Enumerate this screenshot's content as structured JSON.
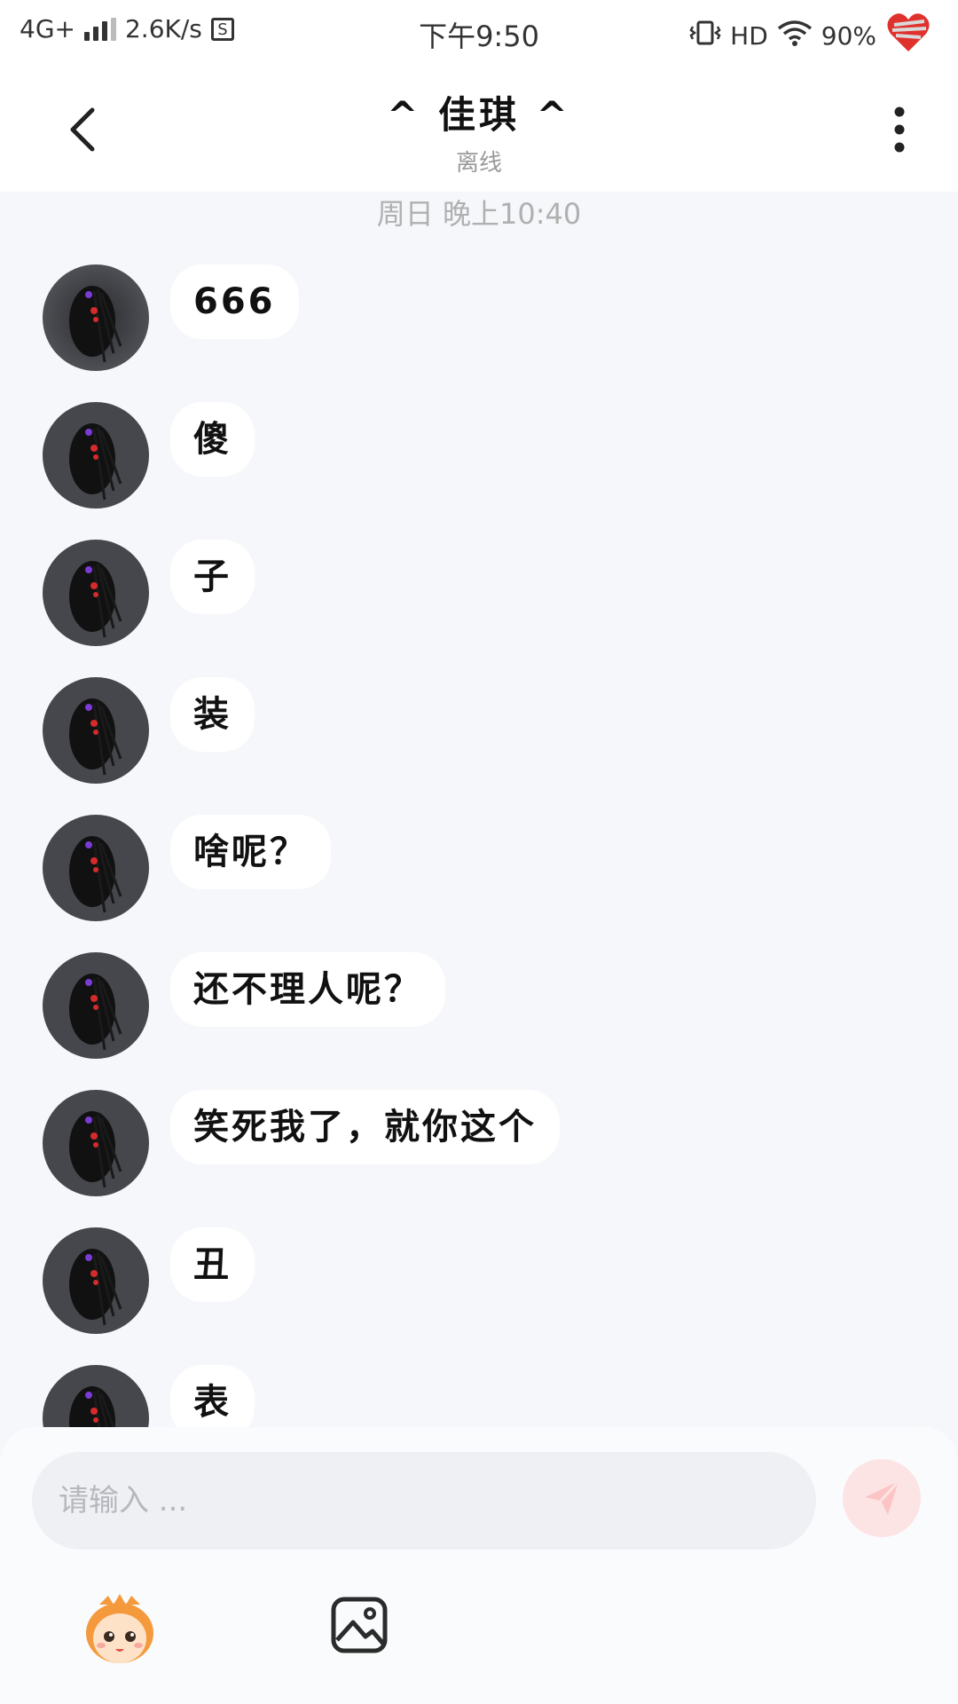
{
  "status_bar": {
    "network": "4G+",
    "speed": "2.6K/s",
    "sim_badge": "S",
    "time": "下午9:50",
    "hd": "HD",
    "battery": "90%"
  },
  "header": {
    "back_icon": "chevron-left-icon",
    "title": "^ 佳琪 ^",
    "status": "离线",
    "more_icon": "vertical-dots-icon"
  },
  "chat": {
    "timestamp": "周日 晚上10:40",
    "messages": [
      {
        "text": "666"
      },
      {
        "text": "傻"
      },
      {
        "text": "子"
      },
      {
        "text": "装"
      },
      {
        "text": "啥呢？"
      },
      {
        "text": "还不理人呢？"
      },
      {
        "text": "笑死我了，就你这个"
      },
      {
        "text": "丑"
      },
      {
        "text": "表"
      }
    ]
  },
  "composer": {
    "placeholder": "请输入 ...",
    "send_icon": "paper-plane-icon",
    "emoji_icon": "cartoon-face-icon",
    "image_icon": "image-icon"
  },
  "colors": {
    "background": "#f6f7fa",
    "bubble": "#ffffff",
    "send_button": "#fde4e4"
  }
}
